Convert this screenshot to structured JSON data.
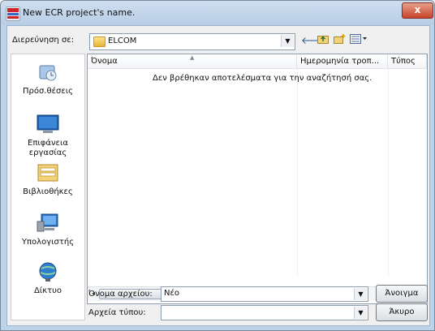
{
  "window": {
    "title": "New ECR project's name.",
    "close_glyph": "x"
  },
  "toolbar": {
    "look_in_label": "Διερεύνηση σε:",
    "look_in_value": "ELCOM",
    "back_icon": "back-arrow-icon",
    "up_icon": "up-folder-icon",
    "new_folder_icon": "new-folder-icon",
    "views_icon": "view-menu-icon"
  },
  "places": [
    {
      "label": "Πρόσ.θέσεις",
      "icon": "recent-places-icon"
    },
    {
      "label": "Επιφάνεια εργασίας",
      "icon": "desktop-icon"
    },
    {
      "label": "Βιβλιοθήκες",
      "icon": "libraries-icon"
    },
    {
      "label": "Υπολογιστής",
      "icon": "computer-icon"
    },
    {
      "label": "Δίκτυο",
      "icon": "network-icon"
    }
  ],
  "filelist": {
    "columns": [
      "Όνομα",
      "Ημερομηνία τροπ...",
      "Τύπος"
    ],
    "empty_message": "Δεν βρέθηκαν αποτελέσματα για την αναζήτησή σας."
  },
  "footer": {
    "filename_label": "Όνομα αρχείου:",
    "filename_value": "Νέο",
    "filetype_label": "Αρχεία τύπου:",
    "filetype_value": "",
    "open_label": "Άνοιγμα",
    "cancel_label": "Άκυρο"
  },
  "colors": {
    "title_bar": "#bcd3ea",
    "close_button": "#c7432b",
    "dialog_bg": "#f0f0f0"
  }
}
